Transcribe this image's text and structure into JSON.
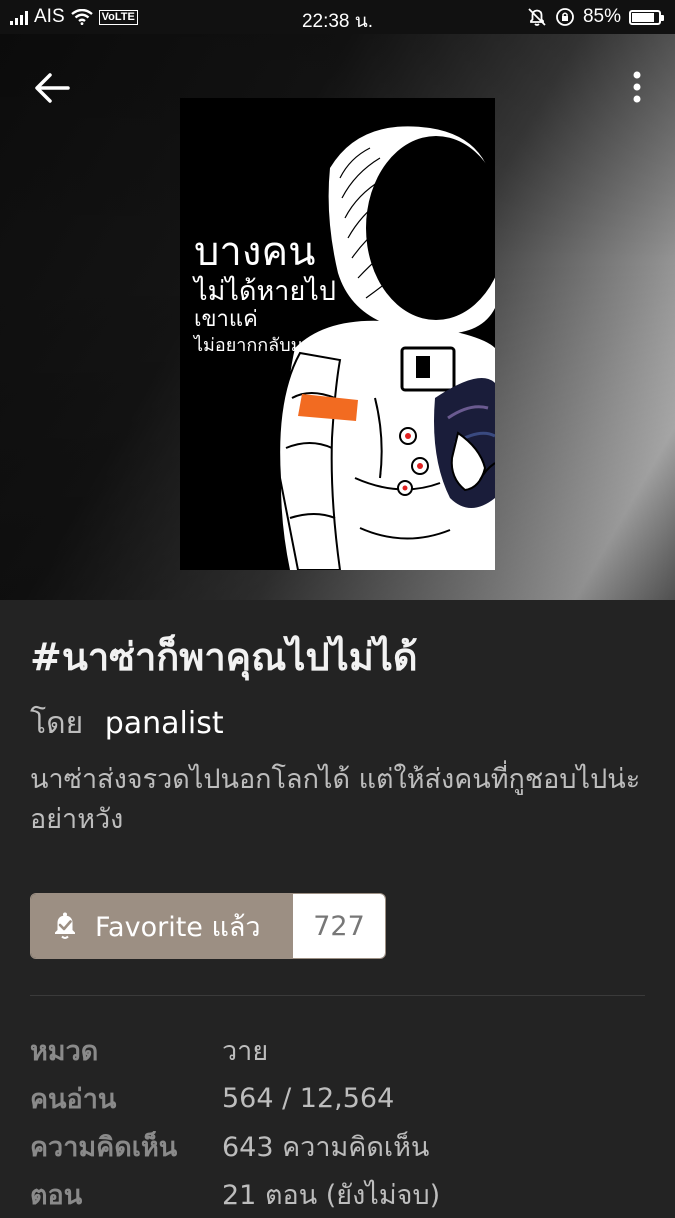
{
  "status_bar": {
    "carrier": "AIS",
    "volte": "VoLTE",
    "time": "22:38 น.",
    "battery": "85%"
  },
  "cover": {
    "line1": "บางคน",
    "line2": "ไม่ได้หายไป",
    "line3": "เขาแค่",
    "line4": "ไม่อยากกลับมา"
  },
  "book": {
    "title": "#นาซ่าก็พาคุณไปไม่ได้",
    "by_label": "โดย",
    "author": "panalist",
    "synopsis": "นาซ่าส่งจรวดไปนอกโลกได้ แต่ให้ส่งคนที่กูชอบไปน่ะอย่าหวัง"
  },
  "favorite": {
    "label": "Favorite แล้ว",
    "count": "727"
  },
  "meta": [
    {
      "label": "หมวด",
      "value": "วาย"
    },
    {
      "label": "คนอ่าน",
      "value": "564 / 12,564"
    },
    {
      "label": "ความคิดเห็น",
      "value": "643 ความคิดเห็น"
    },
    {
      "label": "ตอน",
      "value": "21 ตอน (ยังไม่จบ)"
    }
  ],
  "icons": {
    "back": "back-arrow-icon",
    "more": "more-vert-icon",
    "favorite": "bell-check-icon"
  },
  "colors": {
    "background": "#232323",
    "favorite_button": "#9c8f83",
    "accent_orange": "#f26b21"
  }
}
